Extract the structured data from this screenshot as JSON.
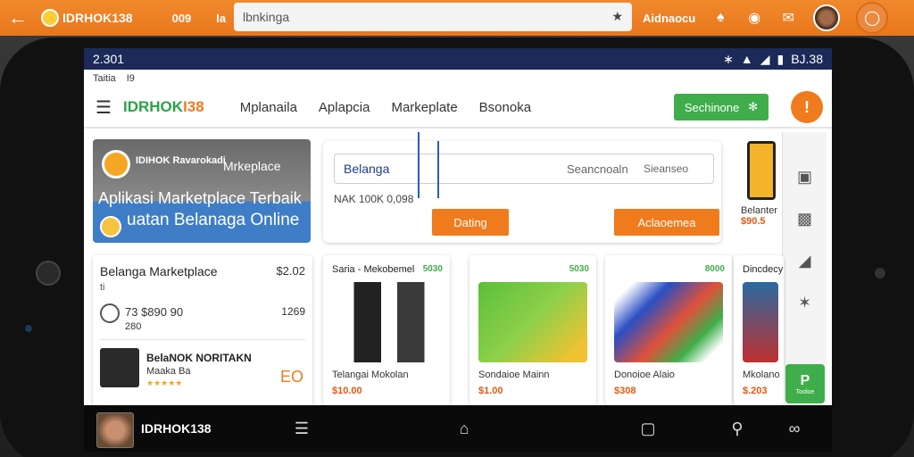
{
  "browser": {
    "brand": "IDRHOK138",
    "tab_a": "009",
    "tab_b": "Ia",
    "address": "lbnkinga",
    "right_label": "Aidnaocu"
  },
  "statusbar": {
    "time": "2.301",
    "right": "BJ.38"
  },
  "subhead": {
    "left": "Taitia",
    "code": "I9"
  },
  "app": {
    "logo_a": "IDRHOK",
    "logo_b": "I38",
    "nav": [
      "Mplanaila",
      "Aplapcia",
      "Markeplate",
      "Bsonoka"
    ],
    "nav_button": "Sechinone"
  },
  "hero": {
    "badge_text": "IDIHOK Ravarokadi",
    "badge_right": "Mrkeplace",
    "line1": "Aplikasi Marketplace Terbaik",
    "line2": "uatan Belanaga Online"
  },
  "search": {
    "value": "Belanga",
    "placeholder_a": "Seancnoaln",
    "placeholder_b": "Sieanseo",
    "meta": "NAK 100K 0,098",
    "btn_left": "Dating",
    "btn_right": "Aclaoemea"
  },
  "promo_phone": {
    "label": "Belanter",
    "price": "$90.5"
  },
  "list": {
    "title": "Belanga Marketplace",
    "title_price": "$2.02",
    "dot": "ti",
    "r2a": "73  $890 90",
    "r2b": "280",
    "r2_price": "1269",
    "r3": "BelaNOK NORITAKN",
    "r3b": "Maaka Ba",
    "r3_icon": "EO"
  },
  "products": [
    {
      "head": "Saria - Mekobemel",
      "tag": "5030",
      "name": "Telangai Mokolan",
      "price": "$10.00"
    },
    {
      "head": "",
      "tag": "5030",
      "name": "Sondaioe Mainn",
      "price": "$1.00"
    },
    {
      "head": "",
      "tag": "8000",
      "name": "Donoioe Alaio",
      "price": "$308"
    },
    {
      "head": "Dincdecy",
      "tag": "",
      "name": "Mkolano",
      "price": "$.203"
    }
  ],
  "rail": {
    "p_label": "P",
    "p_sub": "Tooloe"
  },
  "bottom": {
    "name": "IDRHOK138"
  },
  "colors": {
    "orange": "#ef7b1d",
    "green": "#3fae4a",
    "navy": "#1b2a58"
  }
}
